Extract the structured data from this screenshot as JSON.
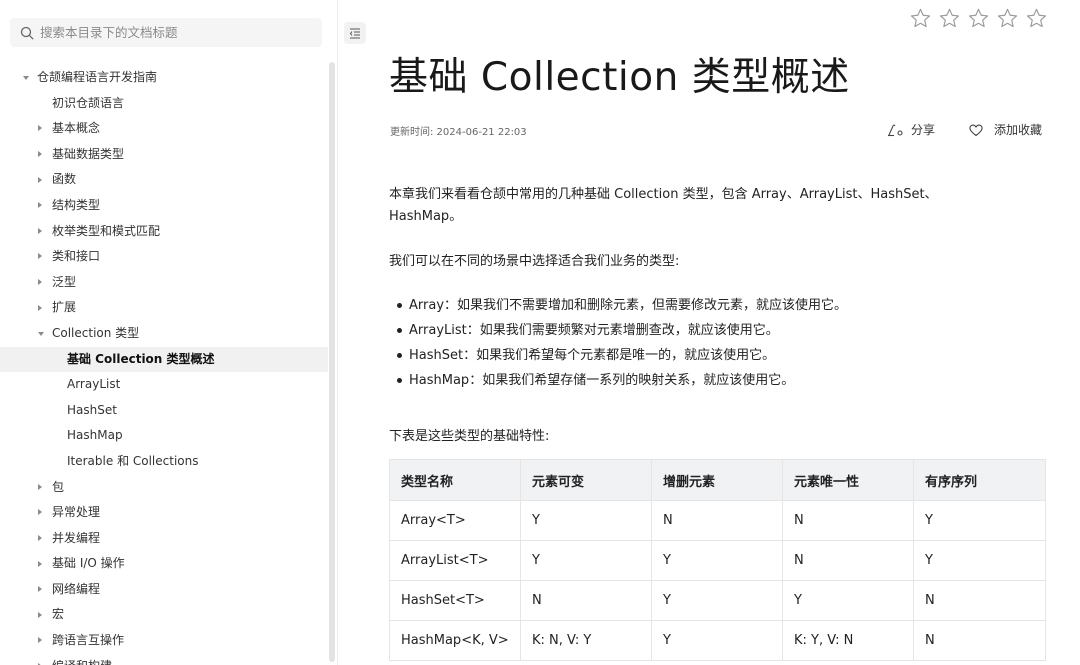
{
  "sidebar": {
    "search_placeholder": "搜索本目录下的文档标题",
    "items": [
      {
        "label": "仓颉编程语言开发指南",
        "indent": 0,
        "arrow": "down",
        "active": false
      },
      {
        "label": "初识仓颉语言",
        "indent": 1,
        "arrow": "none",
        "active": false
      },
      {
        "label": "基本概念",
        "indent": 1,
        "arrow": "right",
        "active": false
      },
      {
        "label": "基础数据类型",
        "indent": 1,
        "arrow": "right",
        "active": false
      },
      {
        "label": "函数",
        "indent": 1,
        "arrow": "right",
        "active": false
      },
      {
        "label": "结构类型",
        "indent": 1,
        "arrow": "right",
        "active": false
      },
      {
        "label": "枚举类型和模式匹配",
        "indent": 1,
        "arrow": "right",
        "active": false
      },
      {
        "label": "类和接口",
        "indent": 1,
        "arrow": "right",
        "active": false
      },
      {
        "label": "泛型",
        "indent": 1,
        "arrow": "right",
        "active": false
      },
      {
        "label": "扩展",
        "indent": 1,
        "arrow": "right",
        "active": false
      },
      {
        "label": "Collection 类型",
        "indent": 1,
        "arrow": "down",
        "active": false
      },
      {
        "label": "基础 Collection 类型概述",
        "indent": 2,
        "arrow": "none",
        "active": true
      },
      {
        "label": "ArrayList",
        "indent": 2,
        "arrow": "none",
        "active": false
      },
      {
        "label": "HashSet",
        "indent": 2,
        "arrow": "none",
        "active": false
      },
      {
        "label": "HashMap",
        "indent": 2,
        "arrow": "none",
        "active": false
      },
      {
        "label": "Iterable 和 Collections",
        "indent": 2,
        "arrow": "none",
        "active": false
      },
      {
        "label": "包",
        "indent": 1,
        "arrow": "right",
        "active": false
      },
      {
        "label": "异常处理",
        "indent": 1,
        "arrow": "right",
        "active": false
      },
      {
        "label": "并发编程",
        "indent": 1,
        "arrow": "right",
        "active": false
      },
      {
        "label": "基础 I/O 操作",
        "indent": 1,
        "arrow": "right",
        "active": false
      },
      {
        "label": "网络编程",
        "indent": 1,
        "arrow": "right",
        "active": false
      },
      {
        "label": "宏",
        "indent": 1,
        "arrow": "right",
        "active": false
      },
      {
        "label": "跨语言互操作",
        "indent": 1,
        "arrow": "right",
        "active": false
      },
      {
        "label": "编译和构建",
        "indent": 1,
        "arrow": "right",
        "active": false
      }
    ]
  },
  "main": {
    "title": "基础 Collection 类型概述",
    "updated": "更新时间: 2024-06-21 22:03",
    "share_label": "分享",
    "favorite_label": "添加收藏",
    "rating_stars": 5,
    "intro": "本章我们来看看仓颉中常用的几种基础 Collection 类型，包含 Array、ArrayList、HashSet、HashMap。",
    "choose_text": "我们可以在不同的场景中选择适合我们业务的类型:",
    "bullets": [
      "Array：如果我们不需要增加和删除元素，但需要修改元素，就应该使用它。",
      "ArrayList：如果我们需要频繁对元素增删查改，就应该使用它。",
      "HashSet：如果我们希望每个元素都是唯一的，就应该使用它。",
      "HashMap：如果我们希望存储一系列的映射关系，就应该使用它。"
    ],
    "table_intro": "下表是这些类型的基础特性:",
    "table": {
      "headers": [
        "类型名称",
        "元素可变",
        "增删元素",
        "元素唯一性",
        "有序序列"
      ],
      "rows": [
        [
          "Array<T>",
          "Y",
          "N",
          "N",
          "Y"
        ],
        [
          "ArrayList<T>",
          "Y",
          "Y",
          "N",
          "Y"
        ],
        [
          "HashSet<T>",
          "N",
          "Y",
          "Y",
          "N"
        ],
        [
          "HashMap<K, V>",
          "K: N, V: Y",
          "Y",
          "K: Y, V: N",
          "N"
        ]
      ]
    }
  }
}
